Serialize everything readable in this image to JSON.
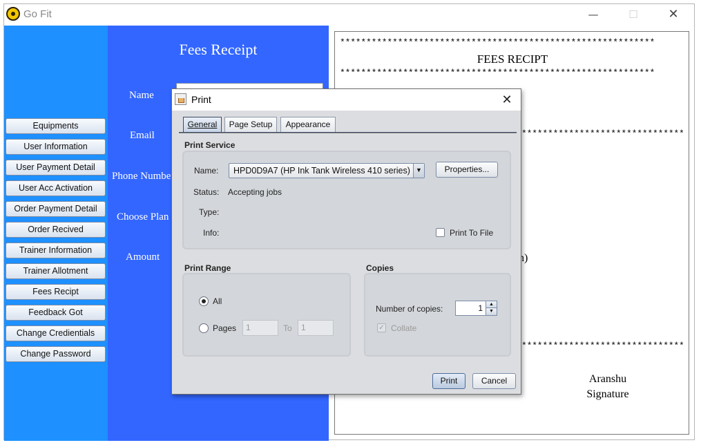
{
  "app": {
    "title": "Go Fit",
    "minimize": "—",
    "maximize": "☐",
    "close": "✕"
  },
  "sidebar": {
    "items": [
      "Equipments",
      "User Information",
      "User Payment Detail",
      "User Acc Activation",
      "Order Payment Detail",
      "Order Recived",
      "Trainer Information",
      "Trainer Allotment",
      "Fees Recipt",
      "Feedback Got",
      "Change Credientials",
      "Change Password"
    ]
  },
  "form": {
    "title": "Fees Receipt",
    "labels": {
      "name": "Name",
      "email": "Email",
      "phone": "Phone Number",
      "plan": "Choose Plan",
      "amount": "Amount"
    }
  },
  "receipt": {
    "stars": "************************************************************",
    "title": "FEES RECIPT",
    "partial_text": "h)",
    "signature_name": "Aranshu",
    "signature_label": "Signature"
  },
  "print_dialog": {
    "title": "Print",
    "close": "✕",
    "tabs": [
      "General",
      "Page Setup",
      "Appearance"
    ],
    "active_tab": "General",
    "print_service": {
      "title": "Print Service",
      "name_label": "Name:",
      "printer": "HPD0D9A7 (HP Ink Tank Wireless 410 series)",
      "properties_button": "Properties...",
      "status_label": "Status:",
      "status_value": "Accepting jobs",
      "type_label": "Type:",
      "info_label": "Info:",
      "print_to_file": "Print To File",
      "print_to_file_checked": false
    },
    "print_range": {
      "title": "Print Range",
      "all_label": "All",
      "pages_label": "Pages",
      "from": "1",
      "to_label": "To",
      "to": "1",
      "selected": "All"
    },
    "copies": {
      "title": "Copies",
      "number_label": "Number of copies:",
      "number": "1",
      "collate_label": "Collate",
      "collate_checked": true,
      "collate_enabled": false
    },
    "buttons": {
      "print": "Print",
      "cancel": "Cancel"
    }
  }
}
